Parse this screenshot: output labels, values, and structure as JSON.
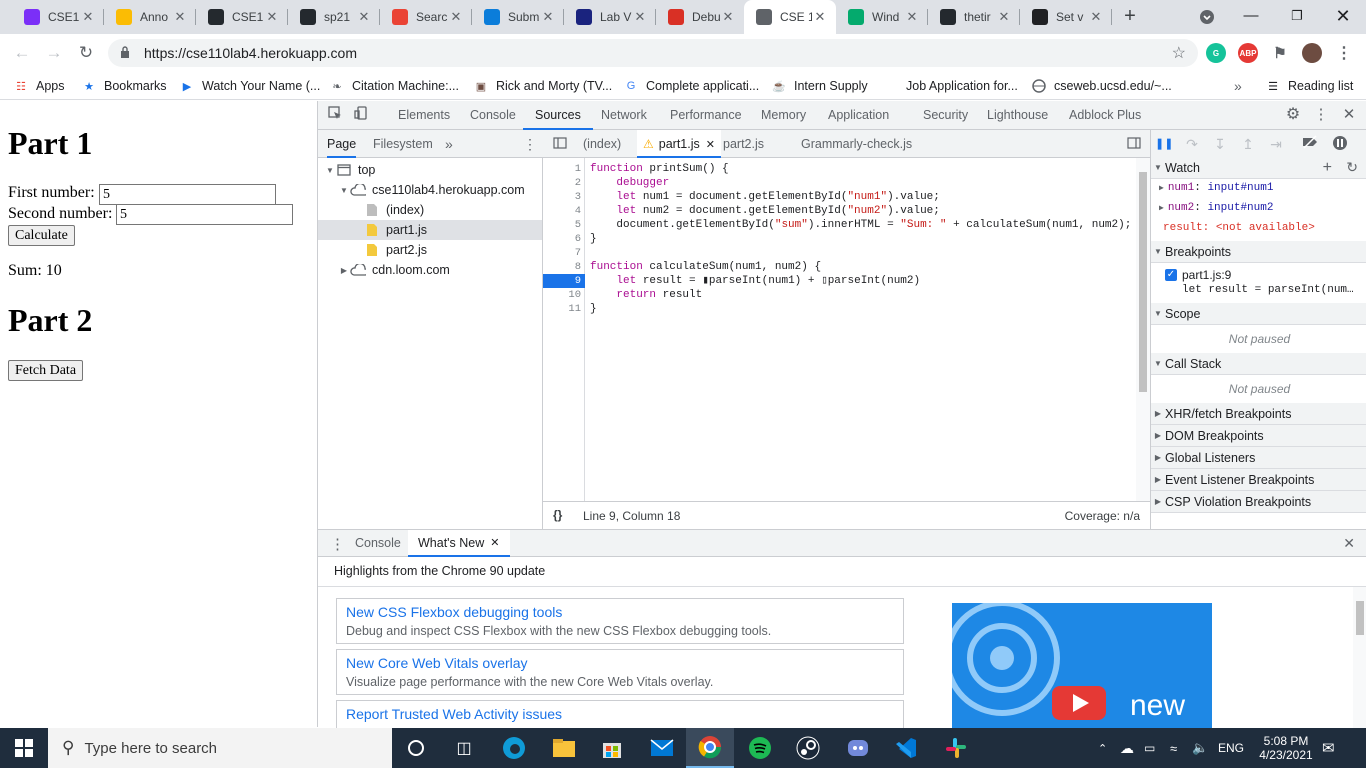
{
  "browser": {
    "tabs": [
      {
        "title": "CSE1",
        "icon": "ed-icon",
        "color": "#7b2ff7"
      },
      {
        "title": "Anno",
        "icon": "google-drive-icon",
        "color": "#fbbc04"
      },
      {
        "title": "CSE1",
        "icon": "github-icon",
        "color": "#24292e"
      },
      {
        "title": "sp21",
        "icon": "github-icon",
        "color": "#24292e"
      },
      {
        "title": "Searc",
        "icon": "gmail-icon",
        "color": "#ea4335"
      },
      {
        "title": "Subm",
        "icon": "chart-icon",
        "color": "#0b7dda"
      },
      {
        "title": "Lab V",
        "icon": "lab-icon",
        "color": "#1a237e"
      },
      {
        "title": "Debu",
        "icon": "debug-icon",
        "color": "#d93025"
      },
      {
        "title": "CSE 1",
        "icon": "globe-icon",
        "color": "#5f6368"
      },
      {
        "title": "Wind",
        "icon": "w3-icon",
        "color": "#04aa6d"
      },
      {
        "title": "thetir",
        "icon": "github-icon",
        "color": "#24292e"
      },
      {
        "title": "Set v",
        "icon": "app-icon",
        "color": "#202124"
      }
    ],
    "url": "https://cse110lab4.herokuapp.com",
    "bookmarks": [
      {
        "label": "Apps",
        "icon": "apps-grid-icon"
      },
      {
        "label": "Bookmarks",
        "icon": "star-icon"
      },
      {
        "label": "Watch Your Name (...",
        "icon": "play-icon"
      },
      {
        "label": "Citation Machine:...",
        "icon": "citation-icon"
      },
      {
        "label": "Rick and Morty (TV...",
        "icon": "tv-icon"
      },
      {
        "label": "Complete applicati...",
        "icon": "google-icon"
      },
      {
        "label": "Intern Supply",
        "icon": "coffee-icon"
      },
      {
        "label": "Job Application for...",
        "icon": "blank-icon"
      },
      {
        "label": "cseweb.ucsd.edu/~...",
        "icon": "globe-icon"
      }
    ],
    "reading_list": "Reading list",
    "overflow": "»"
  },
  "page": {
    "part1_heading": "Part 1",
    "first_label": "First number:",
    "first_value": "5",
    "second_label": "Second number:",
    "second_value": "5",
    "calculate_label": "Calculate",
    "sum_text": "Sum: 10",
    "part2_heading": "Part 2",
    "fetch_label": "Fetch Data"
  },
  "devtools": {
    "tabs": [
      "Elements",
      "Console",
      "Sources",
      "Network",
      "Performance",
      "Memory",
      "Application",
      "Security",
      "Lighthouse",
      "Adblock Plus"
    ],
    "active_tab": "Sources",
    "navigator": {
      "tabs": [
        "Page",
        "Filesystem"
      ],
      "more": "»",
      "tree": [
        {
          "label": "top",
          "level": 0,
          "type": "frame",
          "expanded": true
        },
        {
          "label": "cse110lab4.herokuapp.com",
          "level": 1,
          "type": "cloud",
          "expanded": true
        },
        {
          "label": "(index)",
          "level": 2,
          "type": "doc"
        },
        {
          "label": "part1.js",
          "level": 2,
          "type": "js",
          "selected": true
        },
        {
          "label": "part2.js",
          "level": 2,
          "type": "js"
        },
        {
          "label": "cdn.loom.com",
          "level": 1,
          "type": "cloud",
          "expanded": false
        }
      ]
    },
    "editor": {
      "tabs": [
        {
          "label": "(index)",
          "warn": false,
          "close": false
        },
        {
          "label": "part1.js",
          "warn": true,
          "close": true,
          "active": true
        },
        {
          "label": "part2.js",
          "warn": false,
          "close": false
        },
        {
          "label": "Grammarly-check.js",
          "warn": false,
          "close": false
        }
      ],
      "lines": [
        "function printSum() {",
        "    debugger",
        "    let num1 = document.getElementById(\"num1\").value;",
        "    let num2 = document.getElementById(\"num2\").value;",
        "    document.getElementById(\"sum\").innerHTML = \"Sum: \" + calculateSum(num1, num2);",
        "}",
        "",
        "function calculateSum(num1, num2) {",
        "    let result = ▮parseInt(num1) + ▯parseInt(num2)",
        "    return result",
        "}"
      ],
      "breakpoint_line": 9,
      "status_braces": "{}",
      "status_position": "Line 9, Column 18",
      "status_coverage": "Coverage: n/a"
    },
    "debugger": {
      "watch_title": "Watch",
      "watch_items": [
        {
          "name": "num1",
          "value": "input#num1"
        },
        {
          "name": "num2",
          "value": "input#num2"
        },
        {
          "name": "result",
          "value": "<not available>",
          "error": true
        }
      ],
      "breakpoints_title": "Breakpoints",
      "breakpoint_file": "part1.js:9",
      "breakpoint_code": "let result = parseInt(num…",
      "scope_title": "Scope",
      "scope_status": "Not paused",
      "callstack_title": "Call Stack",
      "callstack_status": "Not paused",
      "sections": [
        "XHR/fetch Breakpoints",
        "DOM Breakpoints",
        "Global Listeners",
        "Event Listener Breakpoints",
        "CSP Violation Breakpoints"
      ]
    },
    "drawer": {
      "tabs": [
        "Console",
        "What's New"
      ],
      "highlights": "Highlights from the Chrome 90 update",
      "items": [
        {
          "title": "New CSS Flexbox debugging tools",
          "desc": "Debug and inspect CSS Flexbox with the new CSS Flexbox debugging tools."
        },
        {
          "title": "New Core Web Vitals overlay",
          "desc": "Visualize page performance with the new Core Web Vitals overlay."
        },
        {
          "title": "Report Trusted Web Activity issues",
          "desc": ""
        }
      ],
      "promo_word": "new"
    }
  },
  "taskbar": {
    "search_placeholder": "Type here to search",
    "time": "5:08 PM",
    "date": "4/23/2021",
    "lang": "ENG"
  },
  "colors": {
    "accent": "#1a73e8",
    "breakpoint": "#1a73e8",
    "error": "#d93025"
  }
}
